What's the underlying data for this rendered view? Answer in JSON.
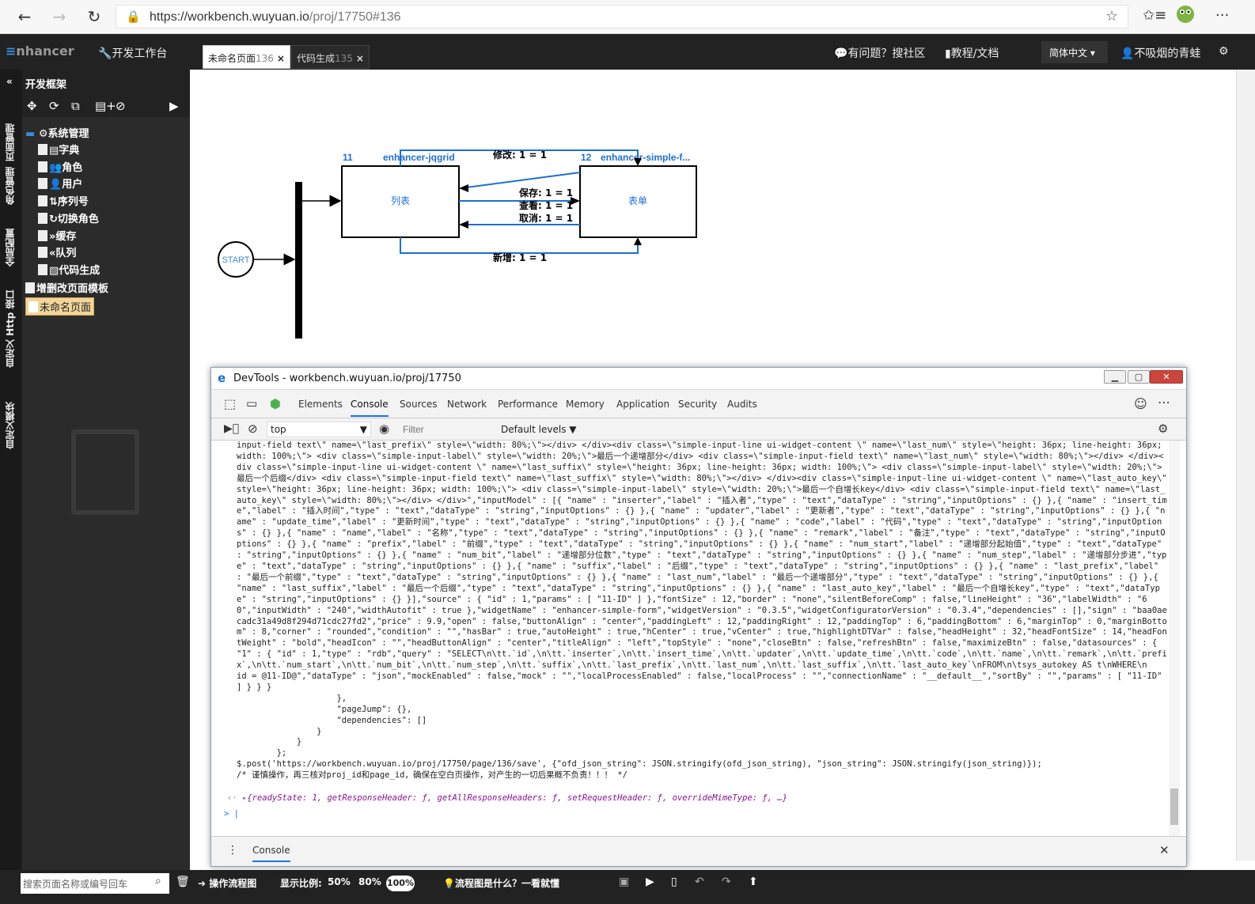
{
  "browser": {
    "url_host": "https://workbench.wuyuan.io",
    "url_path": "/proj/17750#136"
  },
  "header": {
    "logo_prefix": "≡",
    "logo_text": "nhancer",
    "workbench": "开发工作台",
    "tabs": [
      {
        "label": "未命名页面",
        "num": "136"
      },
      {
        "label": "代码生成",
        "num": "135"
      }
    ],
    "help": "有问题？搜社区",
    "docs": "教程/文档",
    "lang": "简体中文",
    "user": "不吸烟的青蛙"
  },
  "left_vbar": [
    "页面管理",
    "角色管理",
    "全局配置",
    "自定义 Http 接口",
    "自定义模块"
  ],
  "sidebar": {
    "title": "开发框架",
    "tree": [
      {
        "label": "系统管理"
      },
      {
        "label": "字典"
      },
      {
        "label": "角色"
      },
      {
        "label": "用户"
      },
      {
        "label": "序列号"
      },
      {
        "label": "切换角色"
      },
      {
        "label": "缓存"
      },
      {
        "label": "队列"
      },
      {
        "label": "代码生成"
      },
      {
        "label": "增删改页面模板"
      },
      {
        "label": "未命名页面"
      }
    ]
  },
  "diagram": {
    "start": "START",
    "node1": {
      "id": "11",
      "name": "enhancer-jqgrid",
      "label": "列表"
    },
    "node2": {
      "id": "12",
      "name": "enhancer-simple-f...",
      "label": "表单"
    },
    "edges": {
      "modify": "修改: 1 = 1",
      "save": "保存: 1 = 1",
      "view": "查看: 1 = 1",
      "cancel": "取消: 1 = 1",
      "add": "新增: 1 = 1"
    }
  },
  "bottom": {
    "search_placeholder": "搜索页面名称或编号回车",
    "flow_btn": "操作流程图",
    "zoom_label": "显示比例:",
    "zoom_50": "50%",
    "zoom_80": "80%",
    "zoom_100": "100%",
    "flow_help": "流程图是什么？一看就懂"
  },
  "devtools": {
    "title": "DevTools - workbench.wuyuan.io/proj/17750",
    "tabs": [
      "Elements",
      "Console",
      "Sources",
      "Network",
      "Performance",
      "Memory",
      "Application",
      "Security",
      "Audits"
    ],
    "context": "top",
    "filter_placeholder": "Filter",
    "levels": "Default levels",
    "drawer_tab": "Console",
    "console_text": "input-field text\\\" name=\\\"last_prefix\\\" style=\\\"width: 80%;\\\"></div> </div><div class=\\\"simple-input-line ui-widget-content \\\" name=\\\"last_num\\\" style=\\\"height: 36px; line-height: 36px; width: 100%;\\\"> <div class=\\\"simple-input-label\\\" style=\\\"width: 20%;\\\">最后一个递增部分</div> <div class=\\\"simple-input-field text\\\" name=\\\"last_num\\\" style=\\\"width: 80%;\\\"></div> </div><div class=\\\"simple-input-line ui-widget-content \\\" name=\\\"last_suffix\\\" style=\\\"height: 36px; line-height: 36px; width: 100%;\\\"> <div class=\\\"simple-input-label\\\" style=\\\"width: 20%;\\\">最后一个后缀</div> <div class=\\\"simple-input-field text\\\" name=\\\"last_suffix\\\" style=\\\"width: 80%;\\\"></div> </div><div class=\\\"simple-input-line ui-widget-content \\\" name=\\\"last_auto_key\\\" style=\\\"height: 36px; line-height: 36px; width: 100%;\\\"> <div class=\\\"simple-input-label\\\" style=\\\"width: 20%;\\\">最后一个自增长key</div> <div class=\\\"simple-input-field text\\\" name=\\\"last_auto_key\\\" style=\\\"width: 80%;\\\"></div> </div>\",\"inputModel\" : [{ \"name\" : \"inserter\",\"label\" : \"插入者\",\"type\" : \"text\",\"dataType\" : \"string\",\"inputOptions\" : {} },{ \"name\" : \"insert_time\",\"label\" : \"插入时间\",\"type\" : \"text\",\"dataType\" : \"string\",\"inputOptions\" : {} },{ \"name\" : \"updater\",\"label\" : \"更新者\",\"type\" : \"text\",\"dataType\" : \"string\",\"inputOptions\" : {} },{ \"name\" : \"update_time\",\"label\" : \"更新时间\",\"type\" : \"text\",\"dataType\" : \"string\",\"inputOptions\" : {} },{ \"name\" : \"code\",\"label\" : \"代码\",\"type\" : \"text\",\"dataType\" : \"string\",\"inputOptions\" : {} },{ \"name\" : \"name\",\"label\" : \"名称\",\"type\" : \"text\",\"dataType\" : \"string\",\"inputOptions\" : {} },{ \"name\" : \"remark\",\"label\" : \"备注\",\"type\" : \"text\",\"dataType\" : \"string\",\"inputOptions\" : {} },{ \"name\" : \"prefix\",\"label\" : \"前缀\",\"type\" : \"text\",\"dataType\" : \"string\",\"inputOptions\" : {} },{ \"name\" : \"num_start\",\"label\" : \"递增部分起始值\",\"type\" : \"text\",\"dataType\" : \"string\",\"inputOptions\" : {} },{ \"name\" : \"num_bit\",\"label\" : \"递增部分位数\",\"type\" : \"text\",\"dataType\" : \"string\",\"inputOptions\" : {} },{ \"name\" : \"num_step\",\"label\" : \"递增部分步进\",\"type\" : \"text\",\"dataType\" : \"string\",\"inputOptions\" : {} },{ \"name\" : \"suffix\",\"label\" : \"后缀\",\"type\" : \"text\",\"dataType\" : \"string\",\"inputOptions\" : {} },{ \"name\" : \"last_prefix\",\"label\" : \"最后一个前缀\",\"type\" : \"text\",\"dataType\" : \"string\",\"inputOptions\" : {} },{ \"name\" : \"last_num\",\"label\" : \"最后一个递增部分\",\"type\" : \"text\",\"dataType\" : \"string\",\"inputOptions\" : {} },{ \"name\" : \"last_suffix\",\"label\" : \"最后一个后缀\",\"type\" : \"text\",\"dataType\" : \"string\",\"inputOptions\" : {} },{ \"name\" : \"last_auto_key\",\"label\" : \"最后一个自增长key\",\"type\" : \"text\",\"dataType\" : \"string\",\"inputOptions\" : {} }],\"source\" : { \"id\" : 1,\"params\" : [ \"11-ID\" ] },\"fontSize\" : 12,\"border\" : \"none\",\"silentBeforeComp\" : false,\"lineHeight\" : \"36\",\"labelWidth\" : \"60\",\"inputWidth\" : \"240\",\"widthAutofit\" : true },\"widgetName\" : \"enhancer-simple-form\",\"widgetVersion\" : \"0.3.5\",\"widgetConfiguratorVersion\" : \"0.3.4\",\"dependencies\" : [],\"sign\" : \"baa0aecadc31a49d8f294d71cdc27fd2\",\"price\" : 9.9,\"open\" : false,\"buttonAlign\" : \"center\",\"paddingLeft\" : 12,\"paddingRight\" : 12,\"paddingTop\" : 6,\"paddingBottom\" : 6,\"marginTop\" : 0,\"marginBottom\" : 8,\"corner\" : \"rounded\",\"condition\" : \"\",\"hasBar\" : true,\"autoHeight\" : true,\"hCenter\" : true,\"vCenter\" : true,\"highlightDTVar\" : false,\"headHeight\" : 32,\"headFontSize\" : 14,\"headFontWeight\" : \"bold\",\"headIcon\" : \"\",\"headButtonAlign\" : \"center\",\"titleAlign\" : \"left\",\"topStyle\" : \"none\",\"closeBtn\" : false,\"refreshBtn\" : false,\"maximizeBtn\" : false,\"datasources\" : { \"1\" : { \"id\" : 1,\"type\" : \"rdb\",\"query\" : \"SELECT\\n\\tt.`id`,\\n\\tt.`inserter`,\\n\\tt.`insert_time`,\\n\\tt.`updater`,\\n\\tt.`update_time`,\\n\\tt.`code`,\\n\\tt.`name`,\\n\\tt.`remark`,\\n\\tt.`prefix`,\\n\\tt.`num_start`,\\n\\tt.`num_bit`,\\n\\tt.`num_step`,\\n\\tt.`suffix`,\\n\\tt.`last_prefix`,\\n\\tt.`last_num`,\\n\\tt.`last_suffix`,\\n\\tt.`last_auto_key`\\nFROM\\n\\tsys_autokey AS t\\nWHERE\\n    id = @11-ID@\",\"dataType\" : \"json\",\"mockEnabled\" : false,\"mock\" : \"\",\"localProcessEnabled\" : false,\"localProcess\" : \"\",\"connectionName\" : \"__default__\",\"sortBy\" : \"\",\"params\" : [ \"11-ID\" ] } } }\n                    },\n                    \"pageJump\": {},\n                    \"dependencies\": []\n                }\n            }\n        };\n$.post('https://workbench.wuyuan.io/proj/17750/page/136/save', {\"ofd_json_string\": JSON.stringify(ofd_json_string), \"json_string\": JSON.stringify(json_string)});\n/* 谨慎操作，再三核对proj_id和page_id，确保在空白页操作，对产生的一切后果概不负责！！！ */",
    "return_text": "{readyState: 1, getResponseHeader: ƒ, getAllResponseHeaders: ƒ, setRequestHeader: ƒ, overrideMimeType: ƒ, …}"
  }
}
